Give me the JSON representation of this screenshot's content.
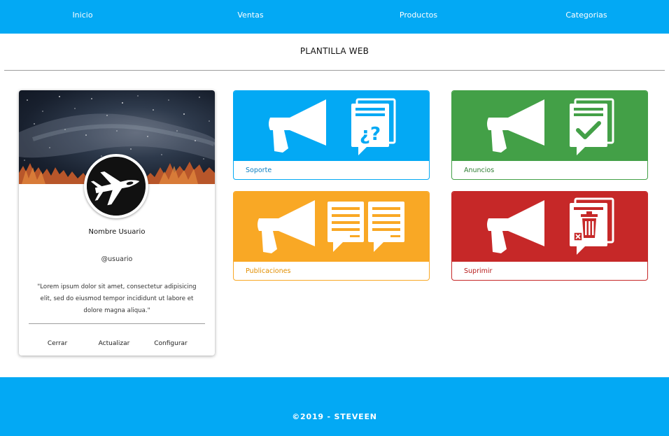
{
  "colors": {
    "primary": "#03a9f4",
    "soporte": "#03a9f4",
    "anuncios": "#43a047",
    "publicaciones": "#f9a825",
    "suprimir": "#c62828"
  },
  "nav": {
    "items": [
      {
        "label": "Inicio"
      },
      {
        "label": "Ventas"
      },
      {
        "label": "Productos"
      },
      {
        "label": "Categorias"
      }
    ]
  },
  "page": {
    "title": "PLANTILLA WEB"
  },
  "profile": {
    "cover_image": "starry-night-sky",
    "avatar_icon": "fighter-jet-icon",
    "name": "Nombre Usuario",
    "handle": "@usuario",
    "quote": "\"Lorem ipsum dolor sit amet, consectetur adipisicing elit, sed do eiusmod tempor incididunt ut labore et dolore magna aliqua.\"",
    "actions": [
      {
        "label": "Cerrar"
      },
      {
        "label": "Actualizar"
      },
      {
        "label": "Configurar"
      }
    ]
  },
  "tiles": [
    {
      "label": "Soporte",
      "icon": "megaphone-question-icon"
    },
    {
      "label": "Anuncios",
      "icon": "megaphone-check-icon"
    },
    {
      "label": "Publicaciones",
      "icon": "megaphone-documents-icon"
    },
    {
      "label": "Suprimir",
      "icon": "megaphone-trash-icon"
    }
  ],
  "footer": {
    "text": "©2019 - STEVEEN"
  }
}
